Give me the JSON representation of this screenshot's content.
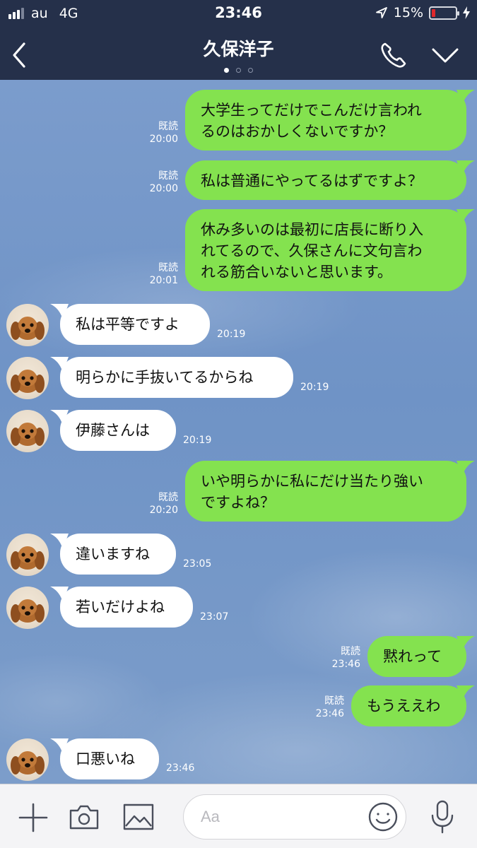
{
  "status": {
    "carrier": "au",
    "network": "4G",
    "time": "23:46",
    "battery": "15%",
    "battery_level": 0.15
  },
  "header": {
    "title": "久保洋子"
  },
  "messages": [
    {
      "text": "大学生ってだけでこんだけ言われ\nるのはおかしくないですか？",
      "read": "既読",
      "time": "20:00"
    },
    {
      "text": "私は普通にやってるはずですよ？",
      "read": "既読",
      "time": "20:00"
    },
    {
      "text": "休み多いのは最初に店長に断り入\nれてるので、久保さんに文句言わ\nれる筋合いないと思います。",
      "read": "既読",
      "time": "20:01"
    },
    {
      "text": "私は平等ですよ",
      "time": "20:19"
    },
    {
      "text": "明らかに手抜いてるからね",
      "time": "20:19"
    },
    {
      "text": "伊藤さんは",
      "time": "20:19"
    },
    {
      "text": "いや明らかに私にだけ当たり強い\nですよね？",
      "read": "既読",
      "time": "20:20"
    },
    {
      "text": "違いますね",
      "time": "23:05"
    },
    {
      "text": "若いだけよね",
      "time": "23:07"
    },
    {
      "text": "黙れって",
      "read": "既読",
      "time": "23:46"
    },
    {
      "text": "もうええわ",
      "read": "既読",
      "time": "23:46"
    },
    {
      "text": "口悪いね",
      "time": "23:46"
    }
  ],
  "input": {
    "placeholder": "Aa"
  },
  "icons": {
    "back": "chevron-left-icon",
    "call": "phone-icon",
    "menu": "chevron-down-icon",
    "add": "plus-icon",
    "camera": "camera-icon",
    "image": "image-icon",
    "emoji": "smiley-icon",
    "mic": "microphone-icon"
  },
  "colors": {
    "header": "#25304a",
    "outgoing": "#84e24f",
    "incoming": "#ffffff",
    "background": "#7a9bc8"
  }
}
